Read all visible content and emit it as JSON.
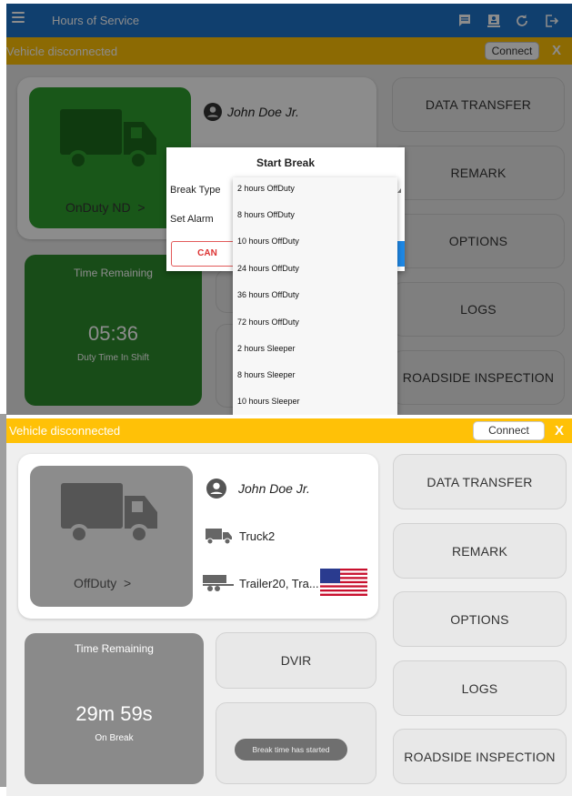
{
  "app": {
    "title": "Hours of Service",
    "menu_icon": "hamburger-menu-icon",
    "toolbar_icons": [
      "message-icon",
      "driver-badge-icon",
      "refresh-icon",
      "logout-icon"
    ]
  },
  "top_screen": {
    "banner": {
      "message": "Vehicle disconnected",
      "connect_label": "Connect",
      "close_label": "X"
    },
    "driver_name": "John Doe Jr.",
    "status_label": "OnDuty ND",
    "status_chevron": ">",
    "timer": {
      "label": "Time Remaining",
      "value": "05:36",
      "sub": "Duty Time In Shift"
    },
    "right_buttons": [
      "DATA TRANSFER",
      "REMARK",
      "OPTIONS",
      "LOGS",
      "ROADSIDE INSPECTION"
    ],
    "dialog": {
      "title": "Start Break",
      "break_type_label": "Break Type",
      "set_alarm_label": "Set Alarm",
      "cancel_label": "CAN"
    },
    "dropdown_options": [
      "2 hours OffDuty",
      "8 hours OffDuty",
      "10 hours OffDuty",
      "24 hours OffDuty",
      "36 hours OffDuty",
      "72 hours OffDuty",
      "2 hours Sleeper",
      "8 hours Sleeper",
      "10 hours Sleeper"
    ]
  },
  "bottom_screen": {
    "banner": {
      "message": "Vehicle disconnected",
      "connect_label": "Connect",
      "close_label": "X"
    },
    "driver_name": "John Doe Jr.",
    "truck_label": "Truck2",
    "trailer_label": "Trailer20, Tra...",
    "status_label": "OffDuty",
    "status_chevron": ">",
    "timer": {
      "label": "Time Remaining",
      "value": "29m 59s",
      "sub": "On Break"
    },
    "dvir_label": "DVIR",
    "right_buttons": [
      "DATA TRANSFER",
      "REMARK",
      "OPTIONS",
      "LOGS",
      "ROADSIDE INSPECTION"
    ],
    "toast": "Break time has started"
  },
  "colors": {
    "appbar": "#1e73c8",
    "banner": "#ffc107",
    "ondut_green": "#2e9e2e",
    "timer_green": "#2d8a2d",
    "offduty_gray": "#8c8c8c",
    "timer_gray": "#8a8a8a"
  }
}
